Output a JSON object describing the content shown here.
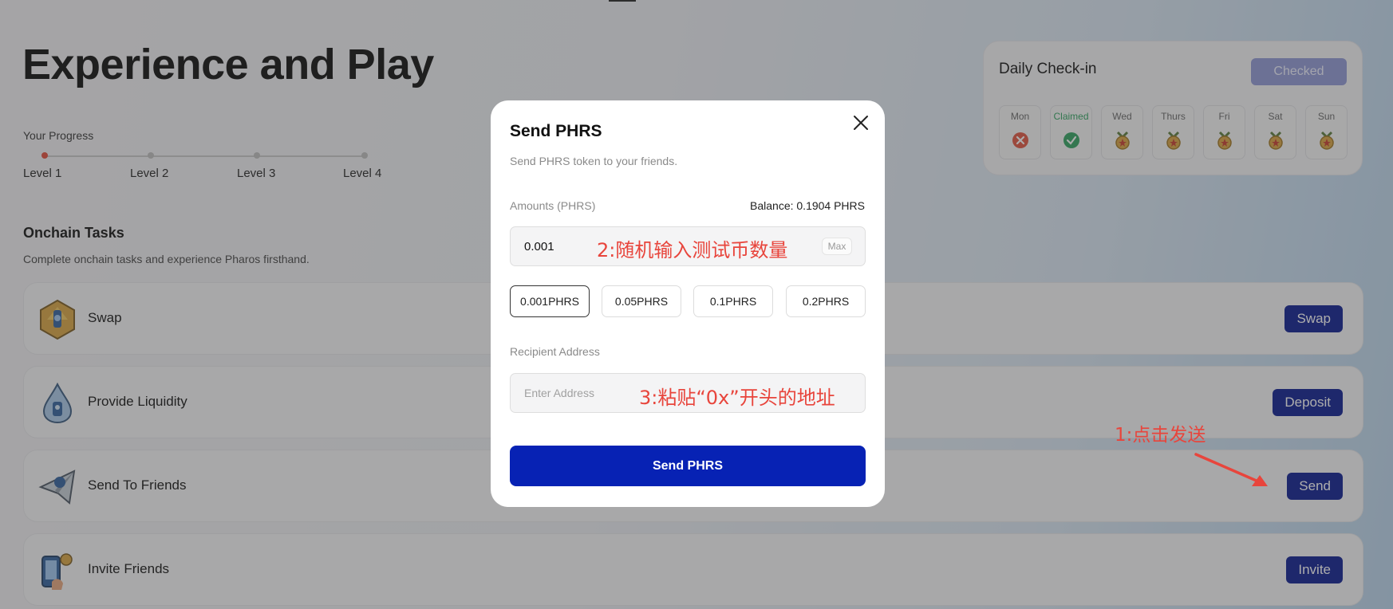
{
  "hero": {
    "title": "Experience and Play"
  },
  "progress": {
    "label": "Your Progress",
    "levels": [
      "Level 1",
      "Level 2",
      "Level 3",
      "Level 4"
    ],
    "current_level": 1
  },
  "onchain": {
    "title": "Onchain Tasks",
    "subtitle": "Complete onchain tasks and experience Pharos firsthand.",
    "tasks": [
      {
        "name": "Swap",
        "button": "Swap",
        "icon": "swap-icon"
      },
      {
        "name": "Provide Liquidity",
        "button": "Deposit",
        "icon": "liquidity-drop-icon"
      },
      {
        "name": "Send To Friends",
        "button": "Send",
        "icon": "paper-plane-icon"
      },
      {
        "name": "Invite Friends",
        "button": "Invite",
        "icon": "invite-phone-icon"
      }
    ]
  },
  "checkin": {
    "title": "Daily Check-in",
    "status_button": "Checked",
    "days": [
      {
        "label": "Mon",
        "state": "missed"
      },
      {
        "label": "Claimed",
        "state": "claimed"
      },
      {
        "label": "Wed",
        "state": "pending"
      },
      {
        "label": "Thurs",
        "state": "pending"
      },
      {
        "label": "Fri",
        "state": "pending"
      },
      {
        "label": "Sat",
        "state": "pending"
      },
      {
        "label": "Sun",
        "state": "pending"
      }
    ]
  },
  "modal": {
    "title": "Send PHRS",
    "subtitle": "Send PHRS token to your friends.",
    "amount_label": "Amounts (PHRS)",
    "balance": "Balance: 0.1904 PHRS",
    "amount_value": "0.001",
    "max_label": "Max",
    "presets": [
      "0.001PHRS",
      "0.05PHRS",
      "0.1PHRS",
      "0.2PHRS"
    ],
    "selected_preset": "0.001PHRS",
    "recipient_label": "Recipient Address",
    "address_placeholder": "Enter Address",
    "submit_label": "Send PHRS"
  },
  "annotations": {
    "step1": "1:点击发送",
    "step2": "2:随机输入测试币数量",
    "step3": "3:粘贴“0x”开头的地址",
    "color": "#e8453c"
  },
  "colors": {
    "primary_button": "#0a1a8f",
    "modal_submit": "#0722b4",
    "checked_button": "#8f98d6",
    "progress_active": "#e24b3a"
  }
}
